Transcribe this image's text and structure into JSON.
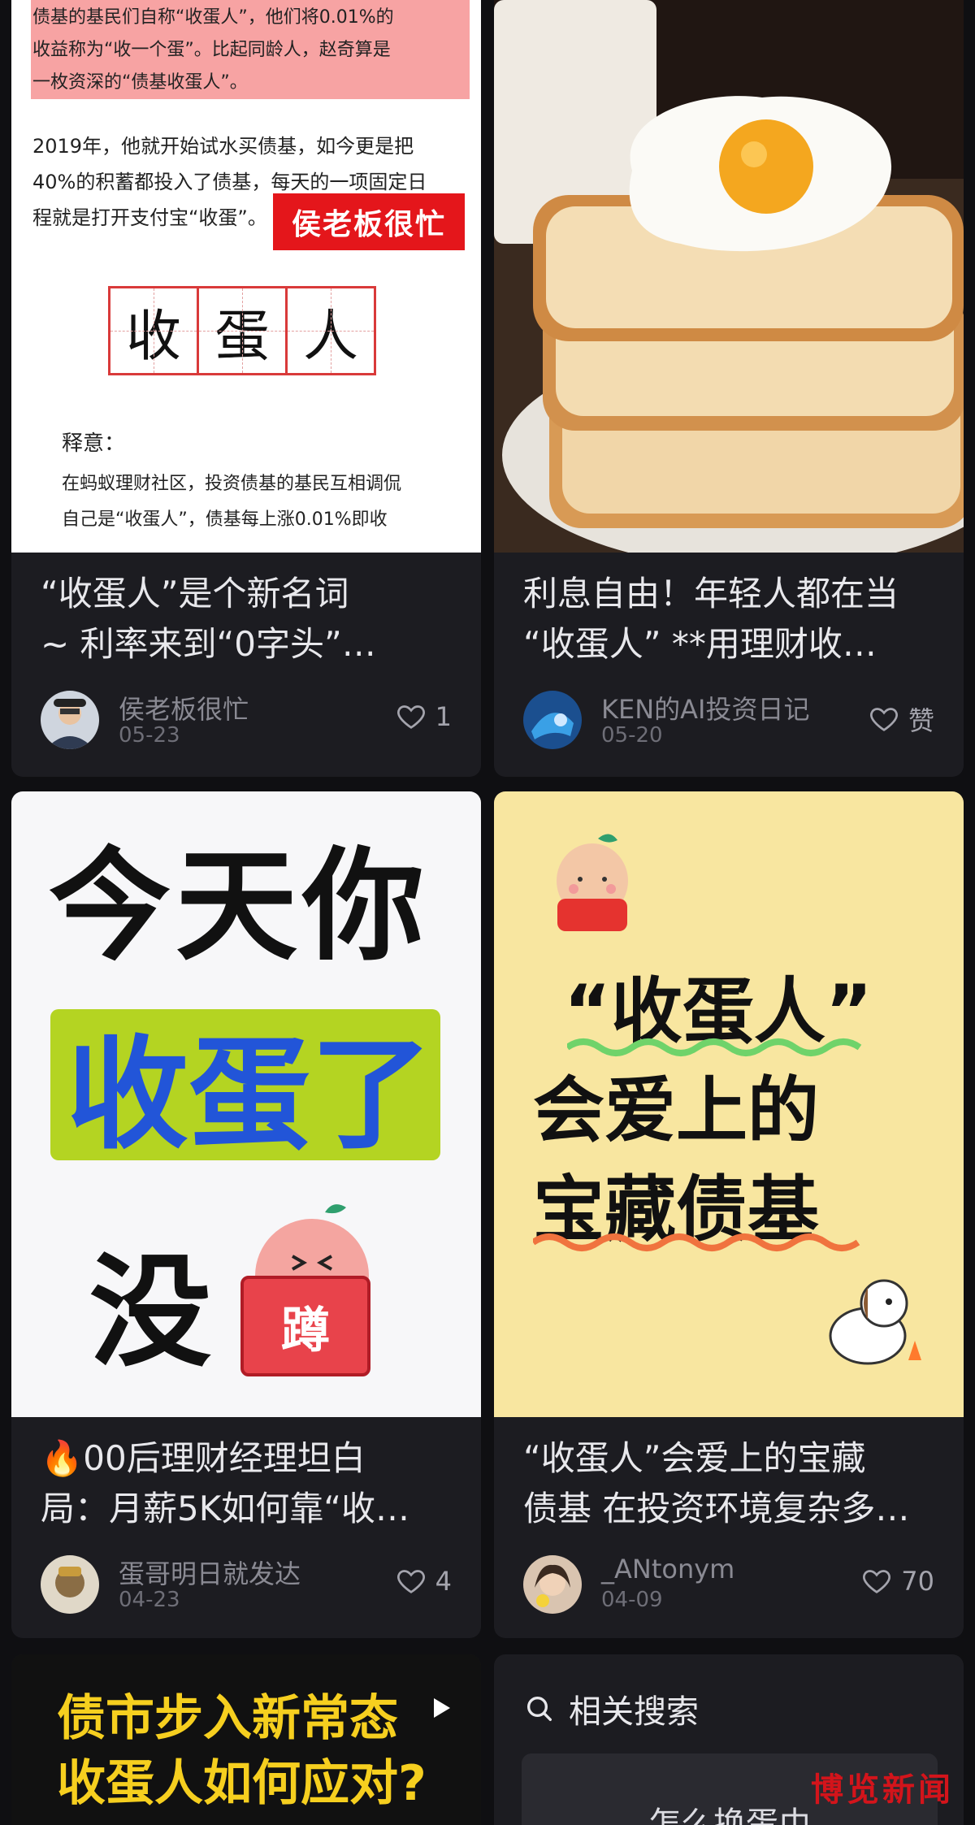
{
  "cards": [
    {
      "title_lines": [
        "“收蛋人”是个新名词",
        "~ 利率来到“0字头”…"
      ],
      "author": "侯老板很忙",
      "date": "05-23",
      "likes": "1",
      "cover": {
        "highlight_text": [
          "债基的基民们自称“收蛋人”，他们将0.01%的",
          "收益称为“收一个蛋”。比起同龄人，赵奇算是",
          "一枚资深的“债基收蛋人”。"
        ],
        "body_text": [
          "2019年，他就开始试水买债基，如今更是把",
          "40%的积蓄都投入了债基，每天的一项固定日",
          "程就是打开支付宝“收蛋”。"
        ],
        "stamp": "侯老板很忙",
        "grid_chars": [
          "收",
          "蛋",
          "人"
        ],
        "gloss_title": "释意：",
        "gloss_text": [
          "在蚂蚁理财社区，投资债基的基民互相调侃",
          "自己是“收蛋人”，债基每上涨0.01%即收"
        ]
      }
    },
    {
      "title_lines": [
        "利息自由！年轻人都在当",
        "“收蛋人” **用理财收…"
      ],
      "author": "KEN的AI投资日记",
      "date": "05-20",
      "likes": "赞"
    },
    {
      "title_lines": [
        "🔥00后理财经理坦白",
        "局：月薪5K如何靠“收…"
      ],
      "author": "蛋哥明日就发达",
      "date": "04-23",
      "likes": "4",
      "cover": {
        "line1": "今天你",
        "line2": "收蛋了",
        "line3": "没",
        "sign": "蹲"
      }
    },
    {
      "title_lines": [
        "“收蛋人”会爱上的宝藏",
        "债基 在投资环境复杂多…"
      ],
      "author": "_ANtonym",
      "date": "04-09",
      "likes": "70",
      "cover": {
        "line1": "“收蛋人”",
        "line2": "会爱上的",
        "line3": "宝藏债基"
      }
    },
    {
      "cover": {
        "line1": "债市步入新常态",
        "line2": "收蛋人如何应对?"
      }
    }
  ],
  "related": {
    "title": "相关搜索",
    "first_item": "怎么换蛋巾"
  },
  "watermark": "博览新闻",
  "colors": {
    "background": "#0f0f12",
    "card": "#1c1c21",
    "stamp_red": "#e4161b",
    "green": "#b4d422"
  }
}
